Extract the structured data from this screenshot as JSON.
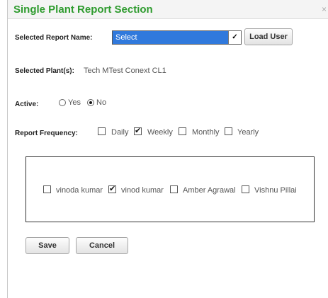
{
  "dialog": {
    "title": "Single Plant Report Section",
    "close_label": "×"
  },
  "report_name": {
    "label": "Selected Report Name:",
    "select_value": "Select",
    "load_button": "Load User"
  },
  "plants": {
    "label": "Selected Plant(s):",
    "value": "Tech MTest Conext CL1"
  },
  "active": {
    "label": "Active:",
    "options": [
      {
        "label": "Yes",
        "selected": false
      },
      {
        "label": "No",
        "selected": true
      }
    ]
  },
  "frequency": {
    "label": "Report Frequency:",
    "options": [
      {
        "label": "Daily",
        "checked": false
      },
      {
        "label": "Weekly",
        "checked": true
      },
      {
        "label": "Monthly",
        "checked": false
      },
      {
        "label": "Yearly",
        "checked": false
      }
    ]
  },
  "users": [
    {
      "label": "vinoda kumar",
      "checked": false
    },
    {
      "label": "vinod kumar",
      "checked": true
    },
    {
      "label": "Amber Agrawal",
      "checked": false
    },
    {
      "label": "Vishnu Pillai",
      "checked": false
    }
  ],
  "actions": {
    "save": "Save",
    "cancel": "Cancel"
  },
  "colors": {
    "title": "#2e9b2e",
    "select_bg": "#3079dc"
  }
}
